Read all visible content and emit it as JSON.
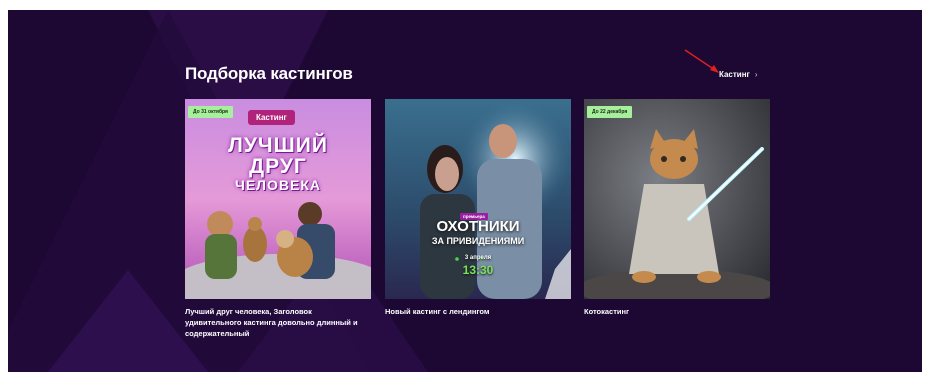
{
  "section": {
    "title": "Подборка кастингов",
    "link_label": "Кастинг",
    "link_chevron": "›"
  },
  "cards": [
    {
      "badge": "До 31 октября",
      "title": "Лучший друг человека, Заголовок удивительного кастинга довольно длинный и содержательный",
      "poster": {
        "pill": "Кастинг",
        "line1": "ЛУЧШИЙ",
        "line2": "ДРУГ",
        "line3": "ЧЕЛОВЕКА"
      }
    },
    {
      "title": "Новый кастинг с лендингом",
      "poster": {
        "tag": "премьера",
        "line1": "ОХОТНИКИ",
        "line2": "ЗА ПРИВИДЕНИЯМИ",
        "date": "3 апреля",
        "time": "13:30"
      }
    },
    {
      "badge": "До 22 декабря",
      "title": "Котокастинг"
    }
  ],
  "colors": {
    "background": "#1c0833",
    "badge": "#a6ef9c",
    "annotation_arrow": "#e02020"
  }
}
